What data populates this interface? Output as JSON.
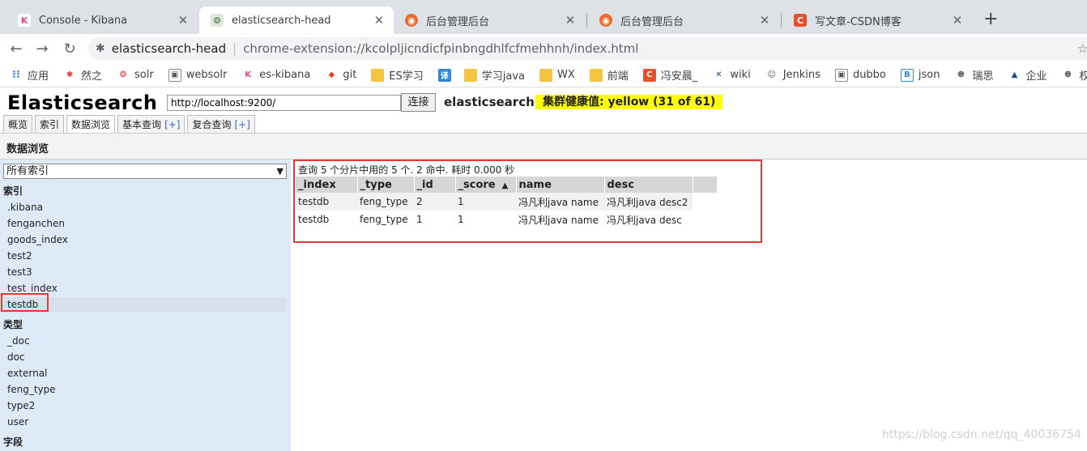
{
  "browser": {
    "tabs": [
      {
        "title": "Console - Kibana",
        "icon": "kibana-icon"
      },
      {
        "title": "elasticsearch-head",
        "icon": "extension-icon"
      },
      {
        "title": "后台管理后台",
        "icon": "admin-icon"
      },
      {
        "title": "后台管理后台",
        "icon": "admin-icon"
      },
      {
        "title": "写文章-CSDN博客",
        "icon": "csdn-icon"
      }
    ],
    "address": {
      "host": "elasticsearch-head",
      "url": "chrome-extension://kcolpljicndicfpinbngdhlfcfmehhnh/index.html"
    },
    "bookmarks": [
      "应用",
      "然之",
      "solr",
      "websolr",
      "es-kibana",
      "git",
      "ES学习",
      "",
      "学习java",
      "WX",
      "前端",
      "冯安晨_",
      "wiki",
      "Jenkins",
      "dubbo",
      "json",
      "瑞思",
      "企业",
      "权限"
    ]
  },
  "header": {
    "brand": "Elasticsearch",
    "url_value": "http://localhost:9200/",
    "connect_label": "连接",
    "cluster_name": "elasticsearch",
    "health": "集群健康值: yellow (31 of 61)"
  },
  "nav": {
    "tabs": [
      {
        "label": "概览",
        "plus": ""
      },
      {
        "label": "索引",
        "plus": ""
      },
      {
        "label": "数据浏览",
        "plus": ""
      },
      {
        "label": "基本查询",
        "plus": "[+]"
      },
      {
        "label": "复合查询",
        "plus": "[+]"
      }
    ],
    "section_title": "数据浏览"
  },
  "sidebar": {
    "index_select": "所有索引",
    "index_header": "索引",
    "indices": [
      ".kibana",
      "fenganchen",
      "goods_index",
      "test2",
      "test3",
      "test_index",
      "testdb"
    ],
    "type_header": "类型",
    "types": [
      "_doc",
      "doc",
      "external",
      "feng_type",
      "type2",
      "user"
    ],
    "field_header": "字段"
  },
  "results": {
    "summary": "查询 5 个分片中用的 5 个. 2 命中. 耗时 0.000 秒",
    "columns": [
      "_index",
      "_type",
      "_id",
      "_score",
      "name",
      "desc"
    ],
    "rows": [
      [
        "testdb",
        "feng_type",
        "2",
        "1",
        "冯凡利java name",
        "冯凡利java desc2"
      ],
      [
        "testdb",
        "feng_type",
        "1",
        "1",
        "冯凡利java name",
        "冯凡利java desc"
      ]
    ],
    "sort_indicator": "▲"
  },
  "watermark": "https://blog.csdn.net/qq_40036754",
  "colors": {
    "health": "#ffff00",
    "sidebar": "#dfeaf8",
    "highlight": "#e53935"
  }
}
